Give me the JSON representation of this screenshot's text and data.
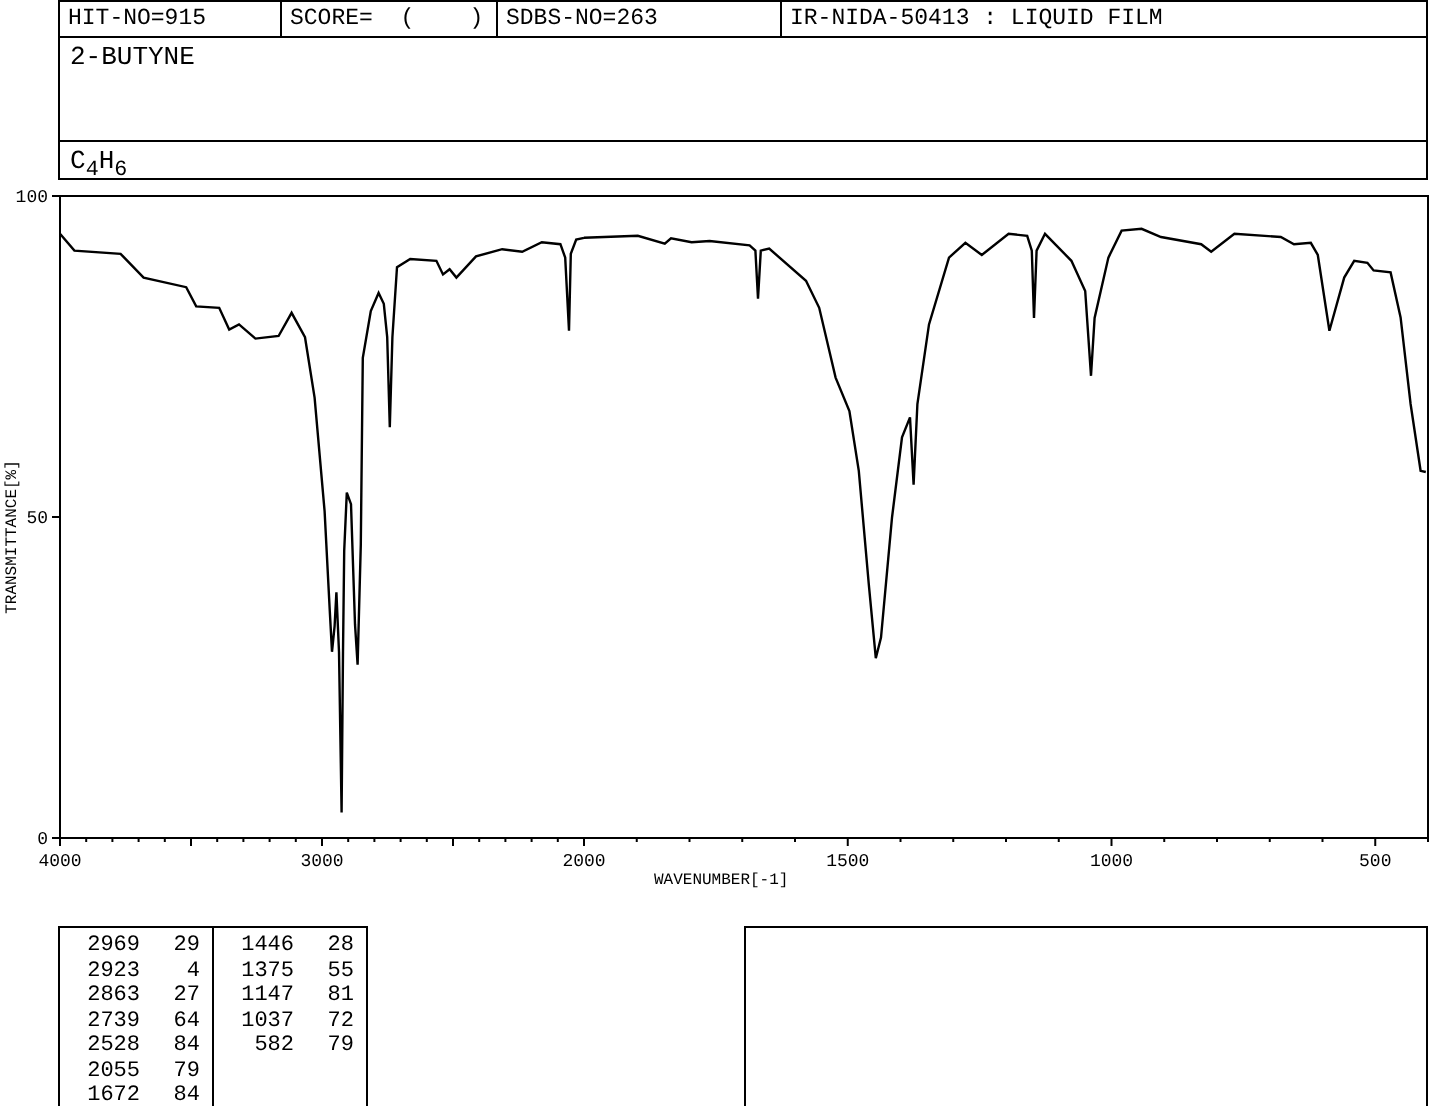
{
  "header": [
    "HIT-NO=915",
    "SCORE=  (    )",
    "SDBS-NO=263",
    "IR-NIDA-50413 : LIQUID FILM"
  ],
  "compound_name": "2-BUTYNE",
  "formula": "C$_{4}$H$_{6}$",
  "spectrum_high_range": {
    "chart_data": {
      "type": "line",
      "ylabel": "TRANSMITTANCE[%]",
      "xlim": [
        4000,
        2000
      ],
      "ylim": [
        0,
        100
      ],
      "xticks": [
        4000,
        3000,
        2000
      ],
      "yticks": [
        0,
        50,
        100
      ],
      "x": [
        4000,
        3945,
        3769,
        3681,
        3518,
        3480,
        3392,
        3354,
        3317,
        3254,
        3166,
        3116,
        3065,
        3028,
        2990,
        2970,
        2962,
        2952,
        2945,
        2935,
        2925,
        2920,
        2915,
        2905,
        2889,
        2874,
        2864,
        2852,
        2844,
        2814,
        2784,
        2764,
        2751,
        2741,
        2731,
        2714,
        2663,
        2563,
        2538,
        2513,
        2487,
        2412,
        2312,
        2236,
        2161,
        2090,
        2072,
        2057,
        2050,
        2030,
        2000
      ],
      "values": [
        94.1,
        91.5,
        91,
        87.3,
        85.8,
        82.8,
        82.6,
        79.2,
        80,
        77.8,
        78.2,
        81.8,
        78,
        68.6,
        50.9,
        35.3,
        29,
        33,
        38.3,
        29,
        4,
        29,
        44.7,
        53.8,
        52,
        33.3,
        27,
        45.7,
        74.8,
        82.1,
        84.9,
        83.2,
        78,
        64,
        78,
        88.9,
        90.2,
        89.9,
        87.8,
        88.6,
        87.3,
        90.6,
        91.7,
        91.3,
        92.8,
        92.5,
        90.4,
        79,
        91,
        93.2,
        93.5
      ]
    }
  },
  "spectrum_low_range": {
    "chart_data": {
      "type": "line",
      "xlabel": "WAVENUMBER[-1]",
      "xlim": [
        2000,
        400
      ],
      "ylim": [
        0,
        100
      ],
      "xticks": [
        1500,
        1000,
        500
      ],
      "x": [
        2000,
        1898,
        1847,
        1835,
        1796,
        1762,
        1686,
        1675,
        1670,
        1665,
        1649,
        1579,
        1554,
        1523,
        1497,
        1479,
        1460,
        1447,
        1437,
        1416,
        1397,
        1382,
        1375,
        1368,
        1346,
        1308,
        1277,
        1246,
        1195,
        1160,
        1151,
        1147,
        1142,
        1126,
        1076,
        1050,
        1039,
        1032,
        1006,
        981,
        943,
        906,
        830,
        811,
        767,
        679,
        654,
        622,
        609,
        587,
        559,
        540,
        515,
        503,
        471,
        452,
        433,
        414,
        404
      ],
      "values": [
        93.5,
        93.8,
        92.6,
        93.4,
        92.8,
        93,
        92.3,
        91.5,
        84,
        91.5,
        91.8,
        86.8,
        82.6,
        71.7,
        66.5,
        57.2,
        39.5,
        28,
        31.2,
        49.9,
        62.4,
        65.5,
        55,
        67.6,
        80,
        90.4,
        92.7,
        90.8,
        94.1,
        93.8,
        91.5,
        81,
        91.5,
        94.1,
        89.9,
        85.2,
        72,
        81,
        90.4,
        94.6,
        94.9,
        93.6,
        92.5,
        91.3,
        94.1,
        93.6,
        92.5,
        92.7,
        90.8,
        79,
        87.3,
        89.9,
        89.6,
        88.4,
        88.1,
        81.1,
        67.6,
        57.2,
        57
      ]
    }
  },
  "peak_table": [
    [
      {
        "wavenumber": "2969",
        "transmittance": "29"
      },
      {
        "wavenumber": "2923",
        "transmittance": "4"
      },
      {
        "wavenumber": "2863",
        "transmittance": "27"
      },
      {
        "wavenumber": "2739",
        "transmittance": "64"
      },
      {
        "wavenumber": "2528",
        "transmittance": "84"
      },
      {
        "wavenumber": "2055",
        "transmittance": "79"
      },
      {
        "wavenumber": "1672",
        "transmittance": "84"
      }
    ],
    [
      {
        "wavenumber": "1446",
        "transmittance": "28"
      },
      {
        "wavenumber": "1375",
        "transmittance": "55"
      },
      {
        "wavenumber": "1147",
        "transmittance": "81"
      },
      {
        "wavenumber": "1037",
        "transmittance": "72"
      },
      {
        "wavenumber": "582",
        "transmittance": "79"
      }
    ]
  ]
}
